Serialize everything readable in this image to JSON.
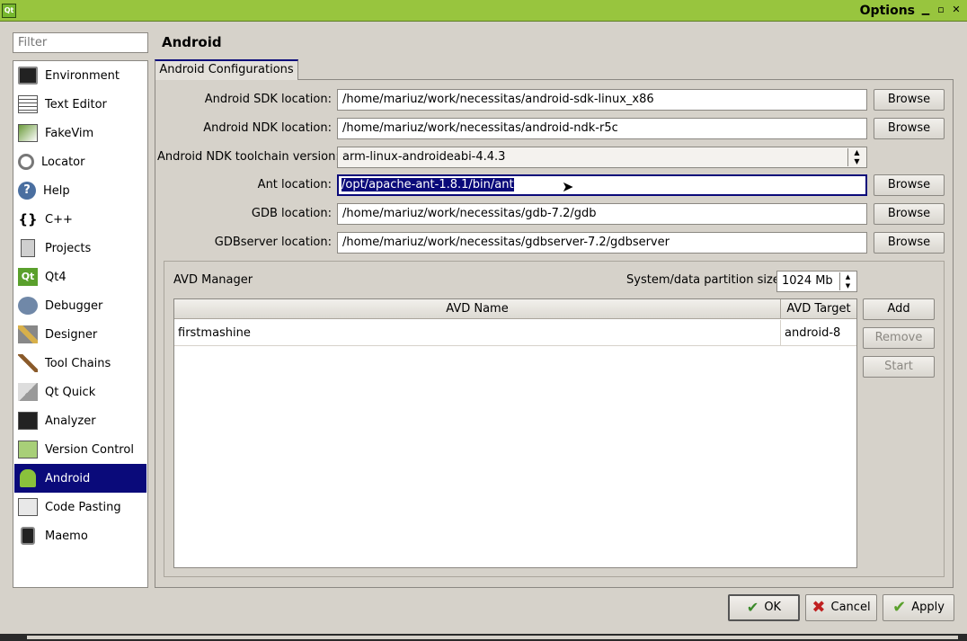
{
  "window": {
    "title": "Options",
    "app_badge": "Qt"
  },
  "filter": {
    "placeholder": "Filter"
  },
  "categories": [
    {
      "label": "Environment",
      "icon": "monitor-icon"
    },
    {
      "label": "Text Editor",
      "icon": "text-document-icon"
    },
    {
      "label": "FakeVim",
      "icon": "fakevim-icon"
    },
    {
      "label": "Locator",
      "icon": "magnifier-icon"
    },
    {
      "label": "Help",
      "icon": "help-question-icon"
    },
    {
      "label": "C++",
      "icon": "braces-icon"
    },
    {
      "label": "Projects",
      "icon": "projects-icon"
    },
    {
      "label": "Qt4",
      "icon": "qt-logo-icon"
    },
    {
      "label": "Debugger",
      "icon": "bug-icon"
    },
    {
      "label": "Designer",
      "icon": "pencil-ruler-icon"
    },
    {
      "label": "Tool Chains",
      "icon": "hammer-icon"
    },
    {
      "label": "Qt Quick",
      "icon": "paper-plane-icon"
    },
    {
      "label": "Analyzer",
      "icon": "oscilloscope-icon"
    },
    {
      "label": "Version Control",
      "icon": "documents-icon"
    },
    {
      "label": "Android",
      "icon": "android-robot-icon",
      "selected": true
    },
    {
      "label": "Code Pasting",
      "icon": "clipboard-globe-icon"
    },
    {
      "label": "Maemo",
      "icon": "phone-device-icon"
    }
  ],
  "page": {
    "title": "Android",
    "tab": "Android Configurations",
    "fields": {
      "sdk": {
        "label": "Android SDK location:",
        "value": "/home/mariuz/work/necessitas/android-sdk-linux_x86"
      },
      "ndk": {
        "label": "Android NDK location:",
        "value": "/home/mariuz/work/necessitas/android-ndk-r5c"
      },
      "toolchain": {
        "label": "Android NDK toolchain version:",
        "value": "arm-linux-androideabi-4.4.3"
      },
      "ant": {
        "label": "Ant location:",
        "value": "/opt/apache-ant-1.8.1/bin/ant"
      },
      "gdb": {
        "label": "GDB location:",
        "value": "/home/mariuz/work/necessitas/gdb-7.2/gdb"
      },
      "gdbserver": {
        "label": "GDBserver location:",
        "value": "/home/mariuz/work/necessitas/gdbserver-7.2/gdbserver"
      }
    },
    "browse_label": "Browse"
  },
  "avd": {
    "title": "AVD Manager",
    "partition_label": "System/data partition size:",
    "partition_value": "1024 Mb",
    "columns": [
      "AVD Name",
      "AVD Target"
    ],
    "rows": [
      {
        "name": "firstmashine",
        "target": "android-8"
      }
    ],
    "buttons": {
      "add": "Add",
      "remove": "Remove",
      "start": "Start"
    }
  },
  "dialog_buttons": {
    "ok": "OK",
    "cancel": "Cancel",
    "apply": "Apply"
  }
}
